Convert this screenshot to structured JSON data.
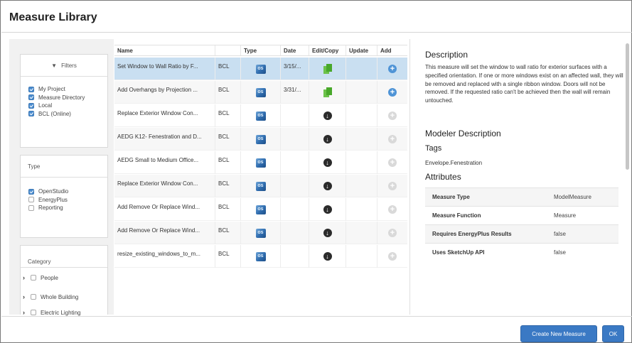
{
  "dialog": {
    "title": "Measure Library"
  },
  "filters": {
    "header": "Filters",
    "items": [
      {
        "label": "My Project",
        "checked": true
      },
      {
        "label": "Measure Directory",
        "checked": true
      },
      {
        "label": "Local",
        "checked": true
      },
      {
        "label": "BCL (Online)",
        "checked": true
      }
    ]
  },
  "type_filter": {
    "header": "Type",
    "items": [
      {
        "label": "OpenStudio",
        "checked": true
      },
      {
        "label": "EnergyPlus",
        "checked": false
      },
      {
        "label": "Reporting",
        "checked": false
      }
    ]
  },
  "category": {
    "header": "Category",
    "items": [
      {
        "label": "People"
      },
      {
        "label": "Whole Building"
      },
      {
        "label": "Electric Lighting"
      }
    ]
  },
  "table": {
    "headers": [
      "Name",
      "",
      "Type",
      "Date",
      "Edit/Copy",
      "Update",
      "Add"
    ],
    "rows": [
      {
        "name": "Set Window to Wall Ratio by F...",
        "source": "BCL",
        "date": "3/15/...",
        "action": "copy",
        "add": "enabled",
        "selected": true
      },
      {
        "name": "Add Overhangs by Projection ...",
        "source": "BCL",
        "date": "3/31/...",
        "action": "copy",
        "add": "enabled",
        "selected": false
      },
      {
        "name": "Replace Exterior Window Con...",
        "source": "BCL",
        "date": "",
        "action": "download",
        "add": "disabled",
        "selected": false
      },
      {
        "name": "AEDG K12- Fenestration and D...",
        "source": "BCL",
        "date": "",
        "action": "download",
        "add": "disabled",
        "selected": false
      },
      {
        "name": "AEDG Small to Medium Office...",
        "source": "BCL",
        "date": "",
        "action": "download",
        "add": "disabled",
        "selected": false
      },
      {
        "name": "Replace Exterior Window Con...",
        "source": "BCL",
        "date": "",
        "action": "download",
        "add": "disabled",
        "selected": false
      },
      {
        "name": "Add Remove Or Replace Wind...",
        "source": "BCL",
        "date": "",
        "action": "download",
        "add": "disabled",
        "selected": false
      },
      {
        "name": "Add Remove Or Replace Wind...",
        "source": "BCL",
        "date": "",
        "action": "download",
        "add": "disabled",
        "selected": false
      },
      {
        "name": "resize_existing_windows_to_m...",
        "source": "BCL",
        "date": "",
        "action": "download",
        "add": "disabled",
        "selected": false
      }
    ]
  },
  "details": {
    "description_heading": "Description",
    "description": "This measure will set the window to wall ratio for exterior surfaces with a specified orientation. If one or more windows exist on an affected wall, they will be removed and replaced with a single ribbon window. Doors will not be removed. If the requested ratio can't be achieved then the wall will remain untouched.",
    "modeler_heading": "Modeler Description",
    "tags_heading": "Tags",
    "tags": "Envelope.Fenestration",
    "attributes_heading": "Attributes",
    "attributes": [
      {
        "key": "Measure Type",
        "value": "ModelMeasure"
      },
      {
        "key": "Measure Function",
        "value": "Measure"
      },
      {
        "key": "Requires EnergyPlus Results",
        "value": "false"
      },
      {
        "key": "Uses SketchUp API",
        "value": "false"
      }
    ]
  },
  "footer": {
    "create_label": "Create New Measure",
    "ok_label": "OK"
  },
  "colors": {
    "accent": "#3a79c4",
    "selected_row": "#c9dff1",
    "copy_green": "#48a82a"
  }
}
